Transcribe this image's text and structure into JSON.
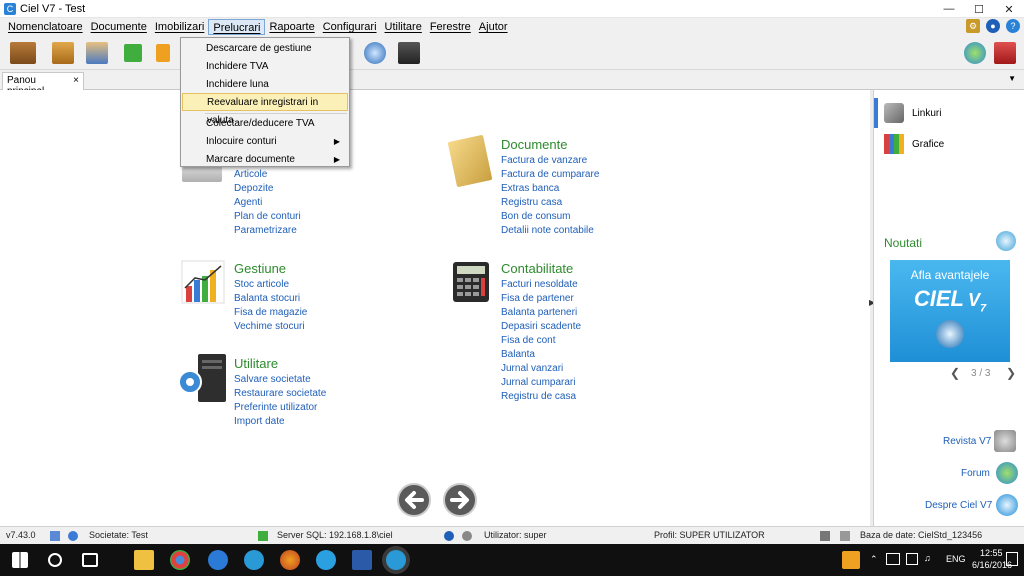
{
  "window": {
    "title": "Ciel V7 - Test"
  },
  "menu": {
    "items": [
      "Nomenclatoare",
      "Documente",
      "Imobilizari",
      "Prelucrari",
      "Rapoarte",
      "Configurari",
      "Utilitare",
      "Ferestre",
      "Ajutor"
    ],
    "active": "Prelucrari"
  },
  "dropdown": {
    "items": [
      {
        "label": "Descarcare de gestiune"
      },
      {
        "label": "Inchidere TVA"
      },
      {
        "label": "Inchidere luna"
      },
      {
        "label": "Reevaluare inregistrari in valuta",
        "highlighted": true
      },
      {
        "label": "Colectare/deducere TVA"
      },
      {
        "label": "Inlocuire conturi",
        "submenu": true
      },
      {
        "label": "Marcare documente",
        "submenu": true
      }
    ]
  },
  "tabs": [
    {
      "label": "Panou principal",
      "close": "×"
    }
  ],
  "sections": {
    "nomenclatoare_links": [
      "Articole",
      "Depozite",
      "Agenti",
      "Plan de conturi",
      "Parametrizare"
    ],
    "documente": {
      "title": "Documente",
      "links": [
        "Factura de vanzare",
        "Factura de cumparare",
        "Extras banca",
        "Registru casa",
        "Bon de consum",
        "Detalii note contabile"
      ]
    },
    "gestiune": {
      "title": "Gestiune",
      "links": [
        "Stoc articole",
        "Balanta stocuri",
        "Fisa de magazie",
        "Vechime stocuri"
      ]
    },
    "contabilitate": {
      "title": "Contabilitate",
      "links": [
        "Facturi nesoldate",
        "Fisa de partener",
        "Balanta parteneri",
        "Depasiri scadente",
        "Fisa de cont",
        "Balanta",
        "Jurnal vanzari",
        "Jurnal cumparari",
        "Registru de casa"
      ]
    },
    "utilitare": {
      "title": "Utilitare",
      "links": [
        "Salvare societate",
        "Restaurare societate",
        "Preferinte utilizator",
        "Import date"
      ]
    }
  },
  "right_panel": {
    "items": [
      "Linkuri",
      "Grafice"
    ],
    "news_title": "Noutati",
    "banner_text": "Afla avantajele",
    "banner_brand": "CIEL",
    "banner_version": "V",
    "banner_version_sub": "7",
    "pager": "3 / 3",
    "footer_links": [
      "Revista V7",
      "Forum",
      "Despre Ciel V7"
    ]
  },
  "status": {
    "version": "v7.43.0",
    "company": "Societate: Test",
    "server": "Server SQL: 192.168.1.8\\ciel",
    "user": "Utilizator: super",
    "profile": "Profil: SUPER UTILIZATOR",
    "db": "Baza de date: CielStd_123456"
  },
  "taskbar": {
    "time": "12:55",
    "date": "6/16/2016",
    "lang": "ENG"
  },
  "colors": {
    "accent": "#3a7bd5",
    "section_title": "#2e8b2e",
    "link": "#1f5fb8",
    "menu_highlight": "#fbf1b8"
  }
}
